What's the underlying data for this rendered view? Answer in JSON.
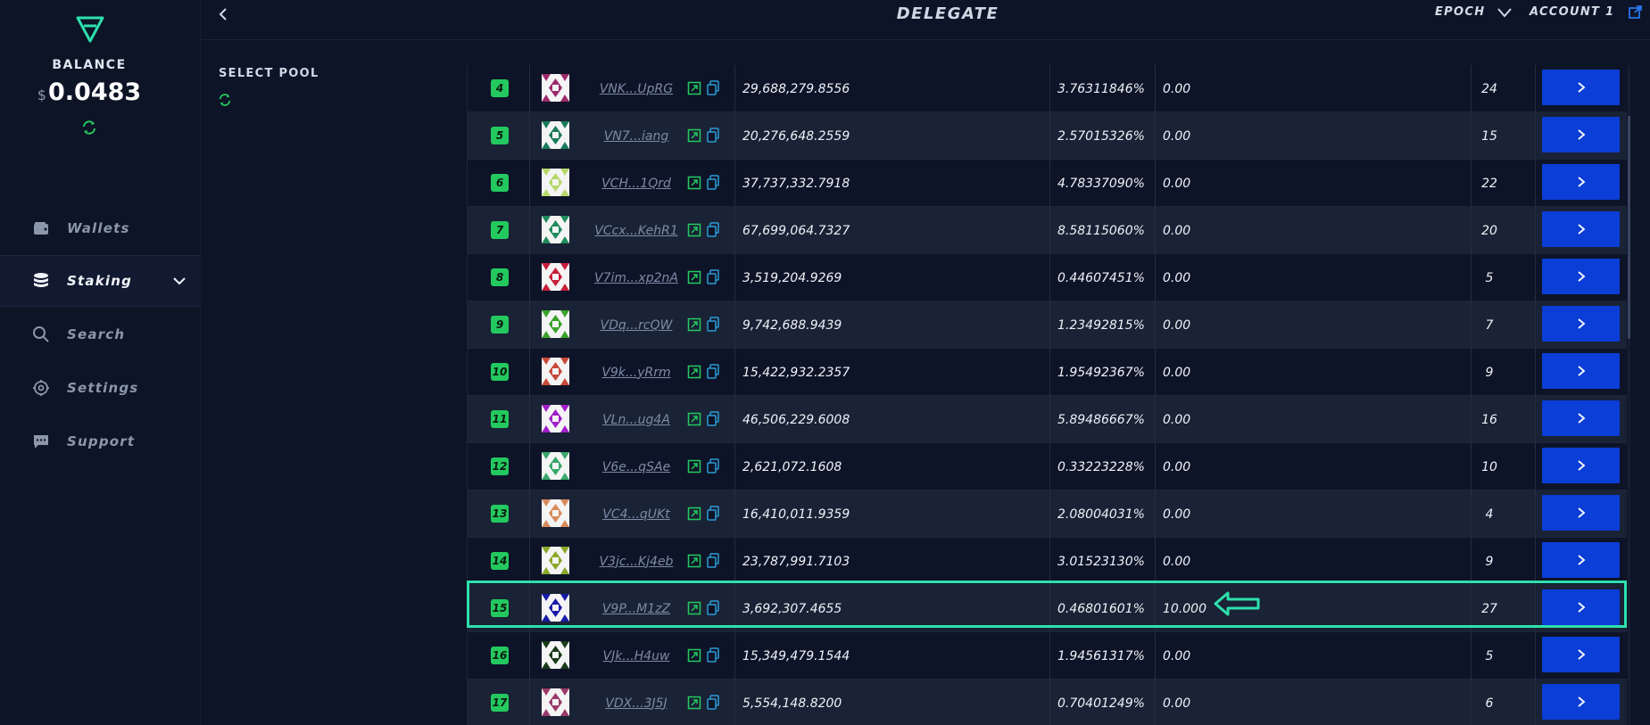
{
  "sidebar": {
    "balance_label": "BALANCE",
    "currency": "$",
    "balance_value": "0.0483",
    "items": [
      {
        "label": "Wallets",
        "icon": "wallet-icon",
        "active": false
      },
      {
        "label": "Staking",
        "icon": "database-icon",
        "active": true
      },
      {
        "label": "Search",
        "icon": "search-icon",
        "active": false
      },
      {
        "label": "Settings",
        "icon": "gear-icon",
        "active": false
      },
      {
        "label": "Support",
        "icon": "chat-icon",
        "active": false
      }
    ]
  },
  "header": {
    "title": "DELEGATE",
    "epoch_label": "EPOCH",
    "account_label": "ACCOUNT 1"
  },
  "pool": {
    "select_label": "SELECT POOL"
  },
  "colors": {
    "accent_green": "#23c95f",
    "highlight": "#2de0ad",
    "button_blue": "#0b3ed6",
    "background": "#0d1427"
  },
  "table": {
    "rows": [
      {
        "rank": "4",
        "address": "VNK...UpRG",
        "stake": "29,688,279.8556",
        "percent": "3.76311846%",
        "fee": "0.00",
        "count": "24"
      },
      {
        "rank": "5",
        "address": "VN7...iang",
        "stake": "20,276,648.2559",
        "percent": "2.57015326%",
        "fee": "0.00",
        "count": "15"
      },
      {
        "rank": "6",
        "address": "VCH...1Qrd",
        "stake": "37,737,332.7918",
        "percent": "4.78337090%",
        "fee": "0.00",
        "count": "22"
      },
      {
        "rank": "7",
        "address": "VCcx...KehR1",
        "stake": "67,699,064.7327",
        "percent": "8.58115060%",
        "fee": "0.00",
        "count": "20"
      },
      {
        "rank": "8",
        "address": "V7im...xp2nA",
        "stake": "3,519,204.9269",
        "percent": "0.44607451%",
        "fee": "0.00",
        "count": "5"
      },
      {
        "rank": "9",
        "address": "VDq...rcQW",
        "stake": "9,742,688.9439",
        "percent": "1.23492815%",
        "fee": "0.00",
        "count": "7"
      },
      {
        "rank": "10",
        "address": "V9k...yRrm",
        "stake": "15,422,932.2357",
        "percent": "1.95492367%",
        "fee": "0.00",
        "count": "9"
      },
      {
        "rank": "11",
        "address": "VLn...ug4A",
        "stake": "46,506,229.6008",
        "percent": "5.89486667%",
        "fee": "0.00",
        "count": "16"
      },
      {
        "rank": "12",
        "address": "V6e...qSAe",
        "stake": "2,621,072.1608",
        "percent": "0.33223228%",
        "fee": "0.00",
        "count": "10"
      },
      {
        "rank": "13",
        "address": "VC4...qUKt",
        "stake": "16,410,011.9359",
        "percent": "2.08004031%",
        "fee": "0.00",
        "count": "4"
      },
      {
        "rank": "14",
        "address": "V3jc...Kj4eb",
        "stake": "23,787,991.7103",
        "percent": "3.01523130%",
        "fee": "0.00",
        "count": "9"
      },
      {
        "rank": "15",
        "address": "V9P...M1zZ",
        "stake": "3,692,307.4655",
        "percent": "0.46801601%",
        "fee": "10.000",
        "count": "27",
        "highlighted": true
      },
      {
        "rank": "16",
        "address": "VJk...H4uw",
        "stake": "15,349,479.1544",
        "percent": "1.94561317%",
        "fee": "0.00",
        "count": "5"
      },
      {
        "rank": "17",
        "address": "VDX...3J5J",
        "stake": "5,554,148.8200",
        "percent": "0.70401249%",
        "fee": "0.00",
        "count": "6"
      }
    ]
  }
}
